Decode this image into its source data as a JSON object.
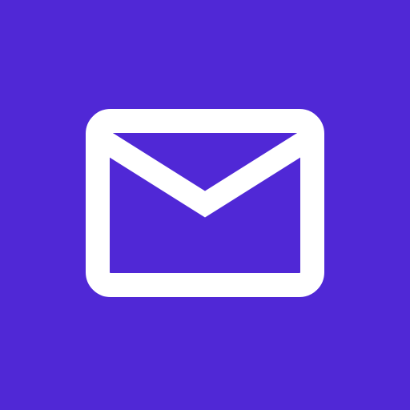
{
  "app_icon": {
    "icon": "mail-envelope-icon",
    "colors": {
      "background": "#5028D6",
      "glyph": "#FFFFFF"
    }
  }
}
